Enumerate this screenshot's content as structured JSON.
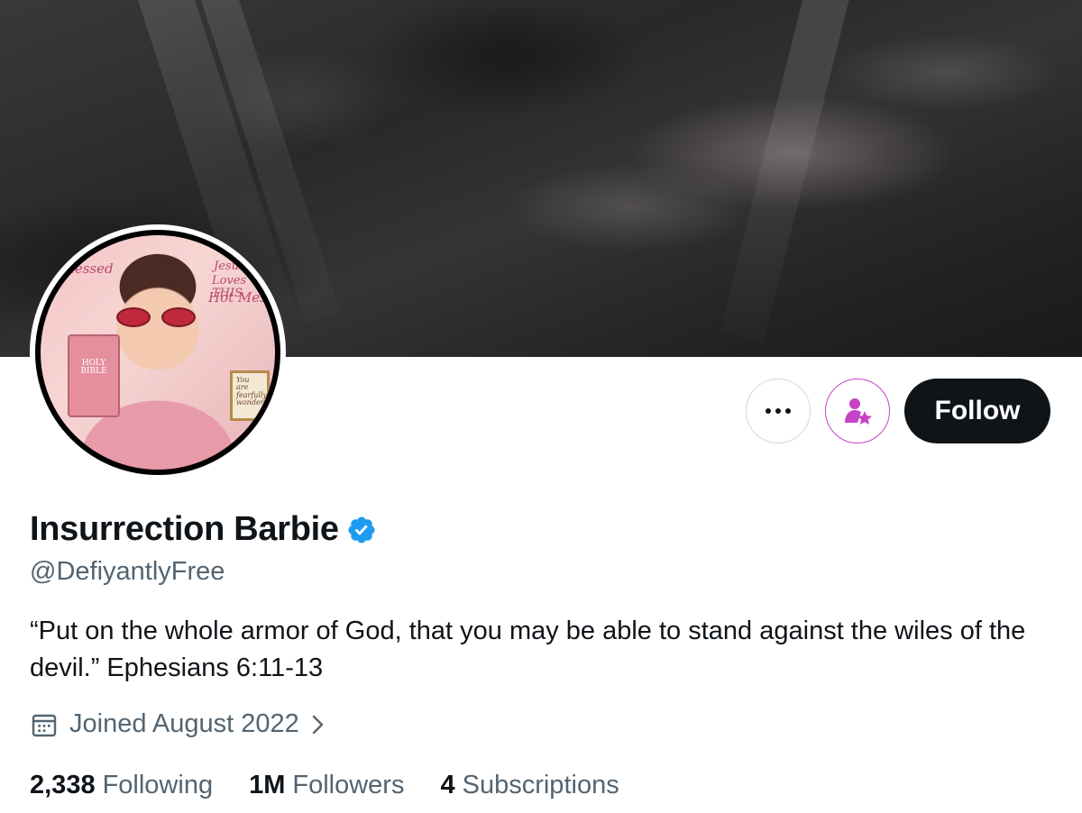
{
  "profile": {
    "display_name": "Insurrection Barbie",
    "handle": "@DefiyantlyFree",
    "bio": "“Put on the whole armor of God, that you may be able to stand against the wiles of the devil.” Ephesians 6:11-13",
    "joined": "Joined August 2022",
    "verified": true
  },
  "avatar_text": {
    "blessed": "Blessed",
    "jesus": "Jesus",
    "loves": "Loves THIS",
    "hot_mess": "Hot Mess",
    "holy_bible": "HOLY BIBLE",
    "sign": "You are fearfully wonderfully"
  },
  "actions": {
    "follow_label": "Follow",
    "more_icon": "more-dots-icon",
    "subscribe_icon": "subscribe-person-star-icon"
  },
  "stats": {
    "following_count": "2,338",
    "following_label": "Following",
    "followers_count": "1M",
    "followers_label": "Followers",
    "subscriptions_count": "4",
    "subscriptions_label": "Subscriptions"
  },
  "colors": {
    "text_primary": "#0f1419",
    "text_secondary": "#536471",
    "verified_blue": "#1d9bf0",
    "subscribe_purple": "#c742c9",
    "follow_button_bg": "#0f1419"
  }
}
